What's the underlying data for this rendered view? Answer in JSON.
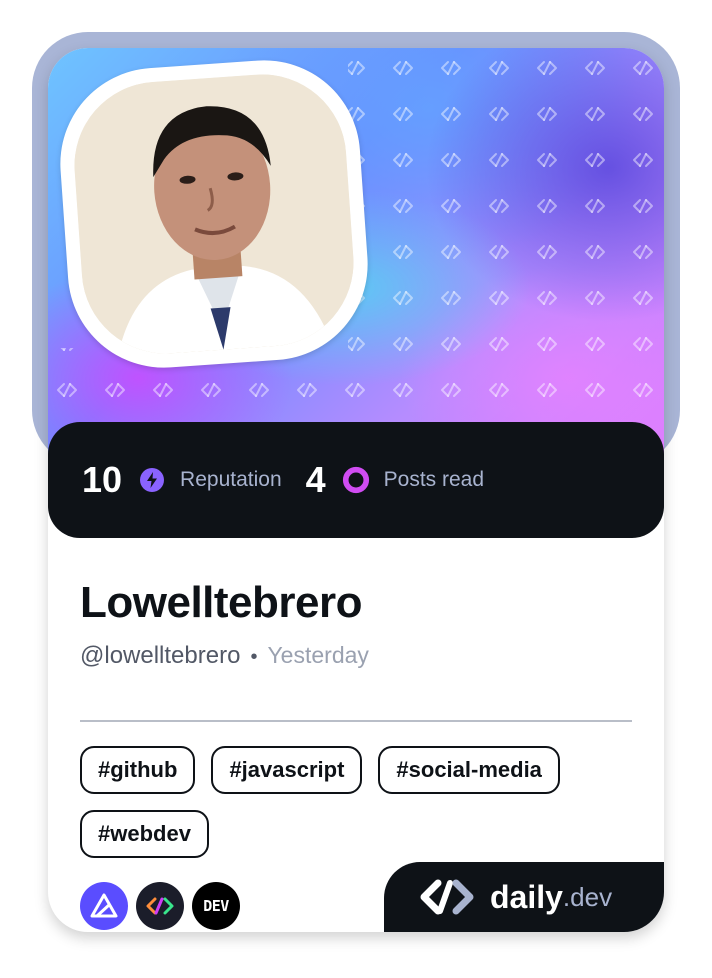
{
  "profile": {
    "name": "Lowelltebrero",
    "handle": "@lowelltebrero",
    "separator": "•",
    "date": "Yesterday",
    "avatar_icon": "user-photo"
  },
  "stats": {
    "reputation_value": "10",
    "reputation_label": "Reputation",
    "reputation_icon": "lightning-icon",
    "posts_value": "4",
    "posts_label": "Posts read",
    "posts_icon": "ring-icon"
  },
  "tags": [
    "#github",
    "#javascript",
    "#social-media",
    "#webdev"
  ],
  "sources": [
    {
      "name": "ai-source-icon",
      "color": "#5a4dff"
    },
    {
      "name": "daily-dev-source-icon",
      "color": "#1b1d2a"
    },
    {
      "name": "dev-to-source-icon",
      "label": "DEV",
      "color": "#000000"
    }
  ],
  "brand": {
    "daily": "daily",
    "dev": ".dev"
  },
  "colors": {
    "frame": "#a9b5d6",
    "dark": "#0e1217",
    "reputation_icon": "#8a63ff",
    "posts_icon": "#d04cf2"
  }
}
